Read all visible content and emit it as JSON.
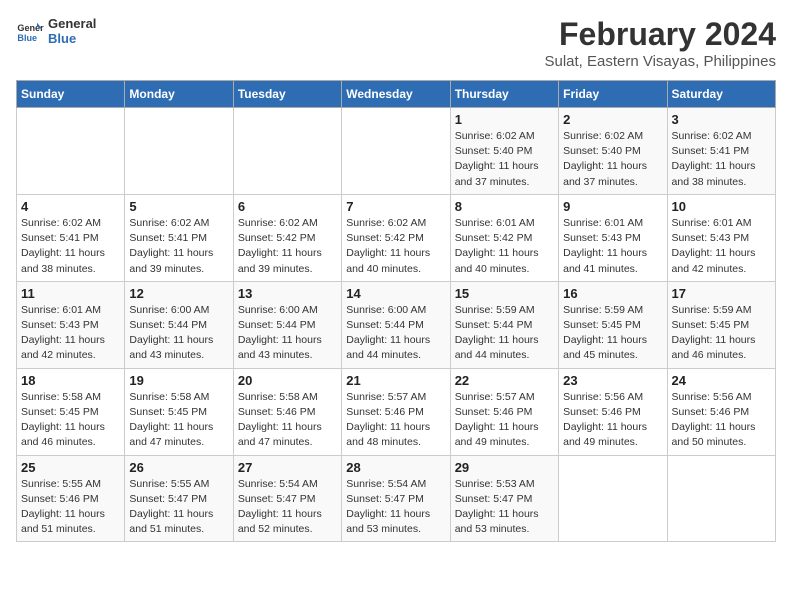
{
  "logo": {
    "text_general": "General",
    "text_blue": "Blue"
  },
  "title": "February 2024",
  "subtitle": "Sulat, Eastern Visayas, Philippines",
  "headers": [
    "Sunday",
    "Monday",
    "Tuesday",
    "Wednesday",
    "Thursday",
    "Friday",
    "Saturday"
  ],
  "weeks": [
    [
      {
        "day": "",
        "info": ""
      },
      {
        "day": "",
        "info": ""
      },
      {
        "day": "",
        "info": ""
      },
      {
        "day": "",
        "info": ""
      },
      {
        "day": "1",
        "info": "Sunrise: 6:02 AM\nSunset: 5:40 PM\nDaylight: 11 hours and 37 minutes."
      },
      {
        "day": "2",
        "info": "Sunrise: 6:02 AM\nSunset: 5:40 PM\nDaylight: 11 hours and 37 minutes."
      },
      {
        "day": "3",
        "info": "Sunrise: 6:02 AM\nSunset: 5:41 PM\nDaylight: 11 hours and 38 minutes."
      }
    ],
    [
      {
        "day": "4",
        "info": "Sunrise: 6:02 AM\nSunset: 5:41 PM\nDaylight: 11 hours and 38 minutes."
      },
      {
        "day": "5",
        "info": "Sunrise: 6:02 AM\nSunset: 5:41 PM\nDaylight: 11 hours and 39 minutes."
      },
      {
        "day": "6",
        "info": "Sunrise: 6:02 AM\nSunset: 5:42 PM\nDaylight: 11 hours and 39 minutes."
      },
      {
        "day": "7",
        "info": "Sunrise: 6:02 AM\nSunset: 5:42 PM\nDaylight: 11 hours and 40 minutes."
      },
      {
        "day": "8",
        "info": "Sunrise: 6:01 AM\nSunset: 5:42 PM\nDaylight: 11 hours and 40 minutes."
      },
      {
        "day": "9",
        "info": "Sunrise: 6:01 AM\nSunset: 5:43 PM\nDaylight: 11 hours and 41 minutes."
      },
      {
        "day": "10",
        "info": "Sunrise: 6:01 AM\nSunset: 5:43 PM\nDaylight: 11 hours and 42 minutes."
      }
    ],
    [
      {
        "day": "11",
        "info": "Sunrise: 6:01 AM\nSunset: 5:43 PM\nDaylight: 11 hours and 42 minutes."
      },
      {
        "day": "12",
        "info": "Sunrise: 6:00 AM\nSunset: 5:44 PM\nDaylight: 11 hours and 43 minutes."
      },
      {
        "day": "13",
        "info": "Sunrise: 6:00 AM\nSunset: 5:44 PM\nDaylight: 11 hours and 43 minutes."
      },
      {
        "day": "14",
        "info": "Sunrise: 6:00 AM\nSunset: 5:44 PM\nDaylight: 11 hours and 44 minutes."
      },
      {
        "day": "15",
        "info": "Sunrise: 5:59 AM\nSunset: 5:44 PM\nDaylight: 11 hours and 44 minutes."
      },
      {
        "day": "16",
        "info": "Sunrise: 5:59 AM\nSunset: 5:45 PM\nDaylight: 11 hours and 45 minutes."
      },
      {
        "day": "17",
        "info": "Sunrise: 5:59 AM\nSunset: 5:45 PM\nDaylight: 11 hours and 46 minutes."
      }
    ],
    [
      {
        "day": "18",
        "info": "Sunrise: 5:58 AM\nSunset: 5:45 PM\nDaylight: 11 hours and 46 minutes."
      },
      {
        "day": "19",
        "info": "Sunrise: 5:58 AM\nSunset: 5:45 PM\nDaylight: 11 hours and 47 minutes."
      },
      {
        "day": "20",
        "info": "Sunrise: 5:58 AM\nSunset: 5:46 PM\nDaylight: 11 hours and 47 minutes."
      },
      {
        "day": "21",
        "info": "Sunrise: 5:57 AM\nSunset: 5:46 PM\nDaylight: 11 hours and 48 minutes."
      },
      {
        "day": "22",
        "info": "Sunrise: 5:57 AM\nSunset: 5:46 PM\nDaylight: 11 hours and 49 minutes."
      },
      {
        "day": "23",
        "info": "Sunrise: 5:56 AM\nSunset: 5:46 PM\nDaylight: 11 hours and 49 minutes."
      },
      {
        "day": "24",
        "info": "Sunrise: 5:56 AM\nSunset: 5:46 PM\nDaylight: 11 hours and 50 minutes."
      }
    ],
    [
      {
        "day": "25",
        "info": "Sunrise: 5:55 AM\nSunset: 5:46 PM\nDaylight: 11 hours and 51 minutes."
      },
      {
        "day": "26",
        "info": "Sunrise: 5:55 AM\nSunset: 5:47 PM\nDaylight: 11 hours and 51 minutes."
      },
      {
        "day": "27",
        "info": "Sunrise: 5:54 AM\nSunset: 5:47 PM\nDaylight: 11 hours and 52 minutes."
      },
      {
        "day": "28",
        "info": "Sunrise: 5:54 AM\nSunset: 5:47 PM\nDaylight: 11 hours and 53 minutes."
      },
      {
        "day": "29",
        "info": "Sunrise: 5:53 AM\nSunset: 5:47 PM\nDaylight: 11 hours and 53 minutes."
      },
      {
        "day": "",
        "info": ""
      },
      {
        "day": "",
        "info": ""
      }
    ]
  ]
}
